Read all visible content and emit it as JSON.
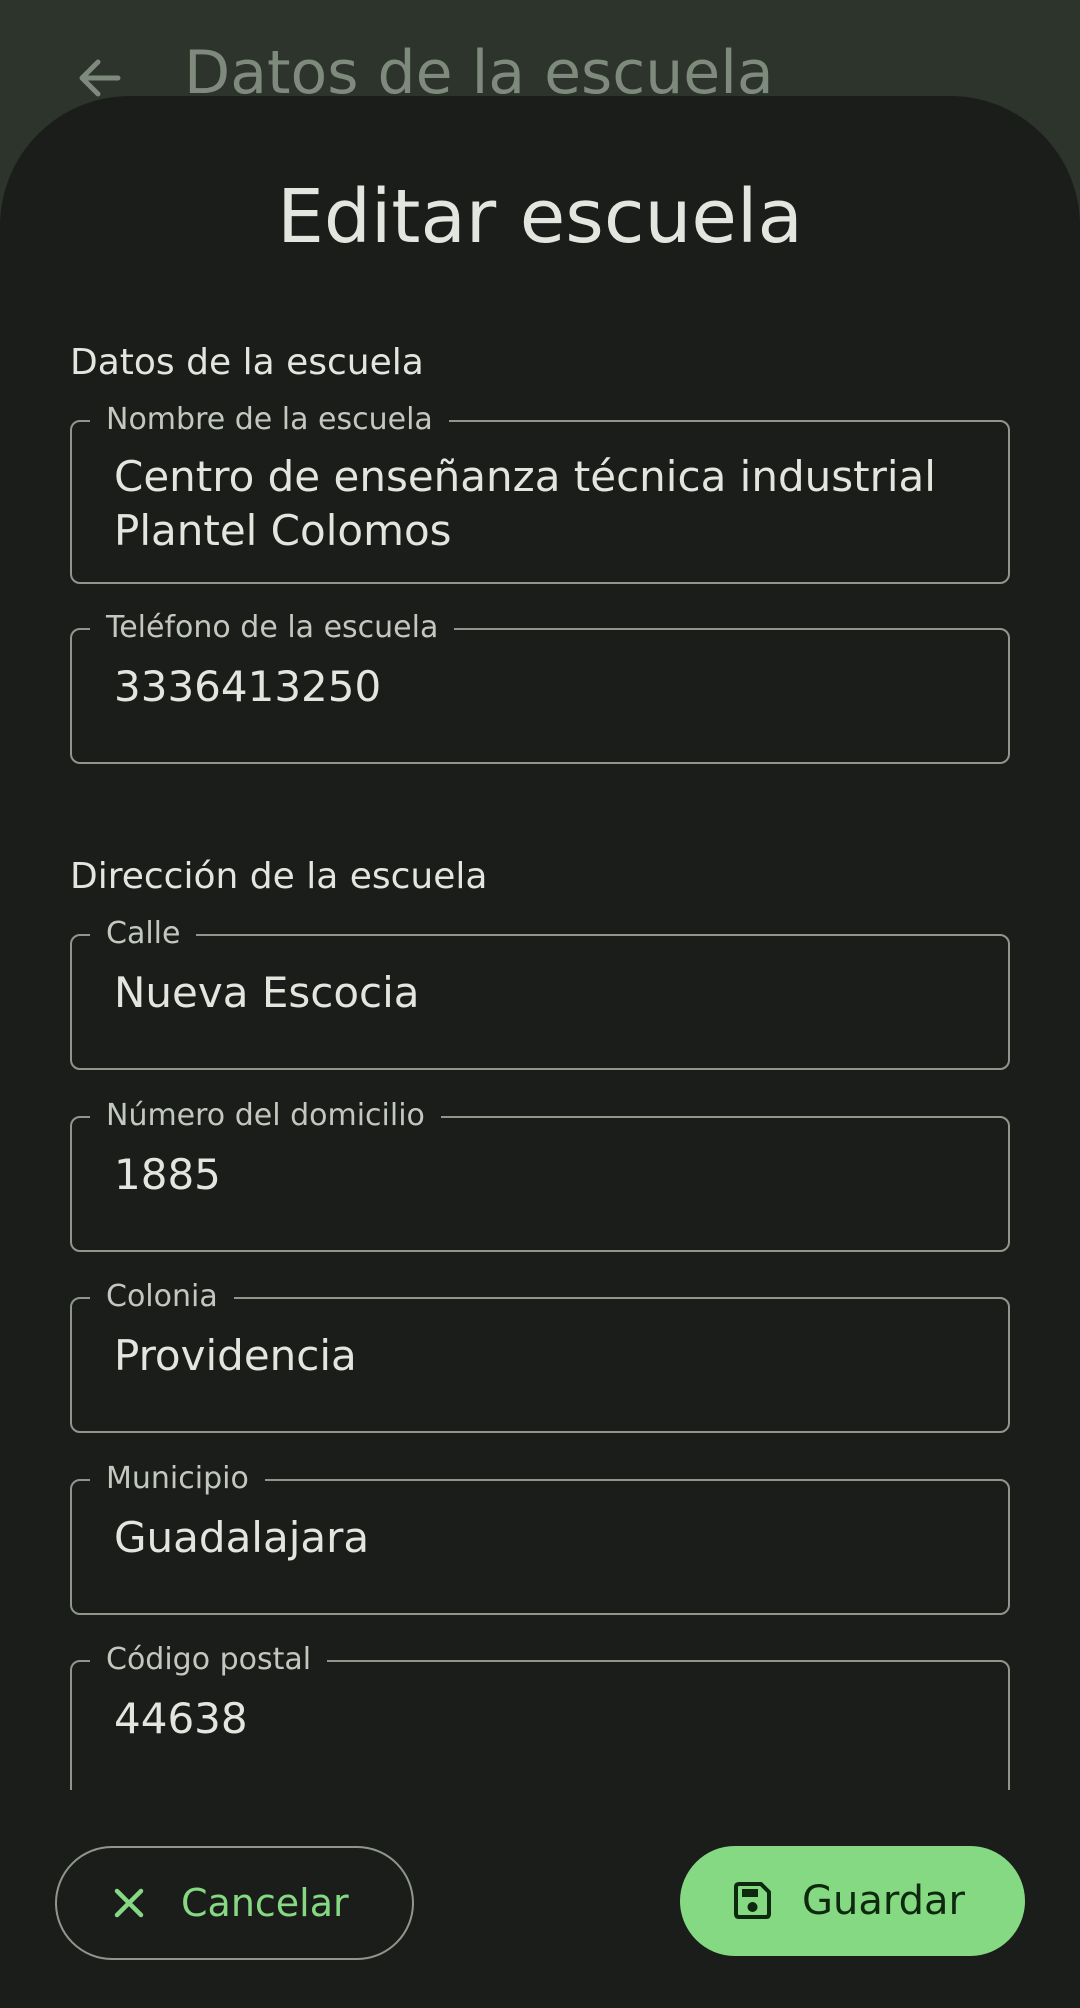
{
  "app_bar": {
    "title": "Datos de la escuela",
    "back_icon": "arrow-left-icon"
  },
  "sheet": {
    "title": "Editar escuela",
    "sections": {
      "school_data_label": "Datos de la escuela",
      "address_label": "Dirección de la escuela"
    },
    "fields": {
      "name": {
        "label": "Nombre de la escuela",
        "value": "Centro de enseñanza técnica industrial Plantel Colomos"
      },
      "phone": {
        "label": "Teléfono de la escuela",
        "value": "3336413250"
      },
      "street": {
        "label": "Calle",
        "value": "Nueva Escocia"
      },
      "number": {
        "label": "Número del domicilio",
        "value": "1885"
      },
      "neighborhood": {
        "label": "Colonia",
        "value": "Providencia"
      },
      "municipality": {
        "label": "Municipio",
        "value": "Guadalajara"
      },
      "zip": {
        "label": "Código postal",
        "value": "44638"
      }
    }
  },
  "actions": {
    "cancel_label": "Cancelar",
    "cancel_icon": "close-icon",
    "save_label": "Guardar",
    "save_icon": "save-icon"
  },
  "colors": {
    "backdrop": "#2c342b",
    "sheet": "#1b1d1b",
    "accent": "#86d983",
    "text": "#e3e6de",
    "outline": "#8f978d"
  }
}
